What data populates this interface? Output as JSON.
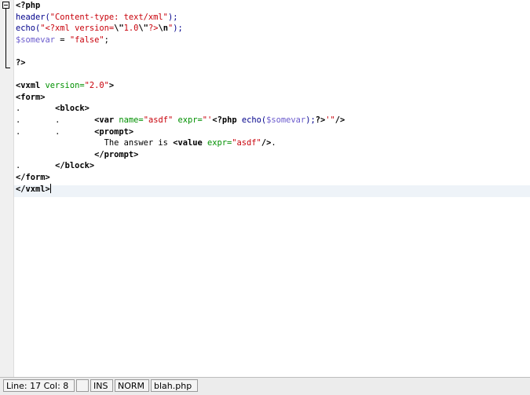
{
  "editor": {
    "lines": [
      [
        {
          "t": "<?php",
          "c": "kw"
        }
      ],
      [
        {
          "t": "header(",
          "c": "fn"
        },
        {
          "t": "\"Content-type: text/xml\"",
          "c": "str"
        },
        {
          "t": ");",
          "c": "fn"
        }
      ],
      [
        {
          "t": "echo(",
          "c": "fn"
        },
        {
          "t": "\"<?xml version=",
          "c": "str"
        },
        {
          "t": "\\\"",
          "c": "esc"
        },
        {
          "t": "1.0",
          "c": "str"
        },
        {
          "t": "\\\"",
          "c": "esc"
        },
        {
          "t": "?>",
          "c": "str"
        },
        {
          "t": "\\n",
          "c": "esc"
        },
        {
          "t": "\"",
          "c": "str"
        },
        {
          "t": ");",
          "c": "fn"
        }
      ],
      [
        {
          "t": "$somevar",
          "c": "var"
        },
        {
          "t": " = ",
          "c": "eq"
        },
        {
          "t": "\"false\"",
          "c": "str"
        },
        {
          "t": ";",
          "c": "eq"
        }
      ],
      [],
      [
        {
          "t": "?>",
          "c": "kw"
        }
      ],
      [],
      [
        {
          "t": "<vxml",
          "c": "kw"
        },
        {
          "t": " version=",
          "c": "attr"
        },
        {
          "t": "\"2.0\"",
          "c": "str"
        },
        {
          "t": ">",
          "c": "kw"
        }
      ],
      [
        {
          "t": "<form>",
          "c": "kw"
        }
      ],
      [
        {
          "t": ".",
          "c": "dot"
        },
        {
          "t": "       "
        },
        {
          "t": "<block>",
          "c": "kw"
        }
      ],
      [
        {
          "t": ".",
          "c": "dot"
        },
        {
          "t": "       "
        },
        {
          "t": ".",
          "c": "dot"
        },
        {
          "t": "       "
        },
        {
          "t": "<var",
          "c": "kw"
        },
        {
          "t": " name=",
          "c": "attr"
        },
        {
          "t": "\"asdf\"",
          "c": "str"
        },
        {
          "t": " expr=",
          "c": "attr"
        },
        {
          "t": "\"'",
          "c": "str"
        },
        {
          "t": "<?php",
          "c": "kw"
        },
        {
          "t": " echo(",
          "c": "fn"
        },
        {
          "t": "$somevar",
          "c": "var"
        },
        {
          "t": ");",
          "c": "fn"
        },
        {
          "t": "?>",
          "c": "kw"
        },
        {
          "t": "'\"",
          "c": "str"
        },
        {
          "t": "/>",
          "c": "kw"
        }
      ],
      [
        {
          "t": ".",
          "c": "dot"
        },
        {
          "t": "       "
        },
        {
          "t": ".",
          "c": "dot"
        },
        {
          "t": "       "
        },
        {
          "t": "<prompt>",
          "c": "kw"
        }
      ],
      [
        {
          "t": "                  The answer is "
        },
        {
          "t": "<value",
          "c": "kw"
        },
        {
          "t": " expr=",
          "c": "attr"
        },
        {
          "t": "\"asdf\"",
          "c": "str"
        },
        {
          "t": "/>",
          "c": "kw"
        },
        {
          "t": "."
        }
      ],
      [
        {
          "t": "                "
        },
        {
          "t": "</prompt>",
          "c": "kw"
        }
      ],
      [
        {
          "t": ".",
          "c": "dot"
        },
        {
          "t": "       "
        },
        {
          "t": "</block>",
          "c": "kw"
        }
      ],
      [
        {
          "t": "</form>",
          "c": "kw"
        }
      ],
      [
        {
          "t": "</vxml>",
          "c": "kw"
        }
      ]
    ]
  },
  "statusbar": {
    "position": "Line: 17 Col: 8",
    "empty": "",
    "insert_mode": "INS",
    "norm_mode": "NORM",
    "filename": "blah.php"
  }
}
